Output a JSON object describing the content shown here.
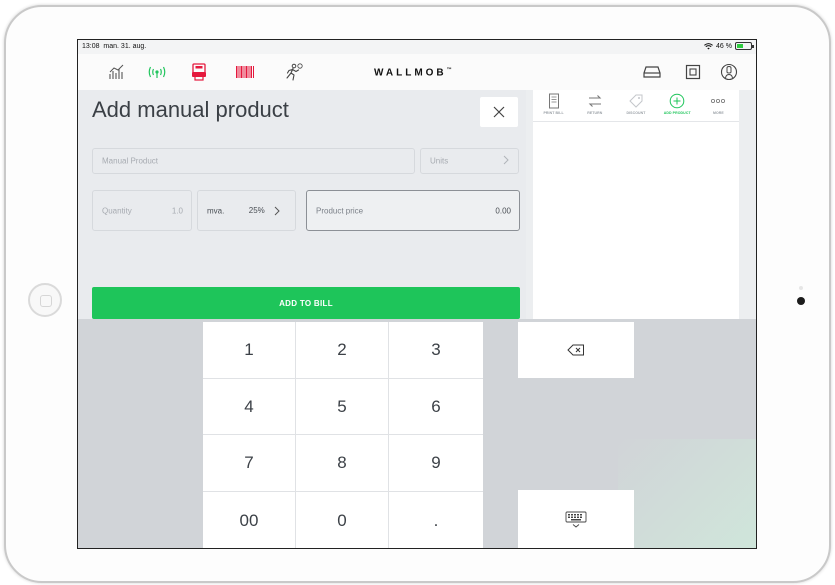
{
  "status": {
    "time": "13:08",
    "date": "man. 31. aug.",
    "battery": "46 %",
    "battery_level": 0.46
  },
  "topbar": {
    "brand": "WALLMOB",
    "brand_tm": "™",
    "left_icons": [
      "chart-icon",
      "wifi-signal-icon",
      "printer-icon",
      "barcode-icon",
      "running-person-icon"
    ],
    "right_icons": [
      "cash-drawer-icon",
      "register-icon",
      "user-icon"
    ],
    "colors": {
      "active_icon": "#22c55e",
      "alert_icon": "#e5183d"
    }
  },
  "form": {
    "title": "Add manual product",
    "close_label": "✕",
    "product_name_placeholder": "Manual Product",
    "units_label": "Units",
    "quantity_label": "Quantity",
    "quantity_value": "1.0",
    "vat_label": "mva.",
    "vat_value": "25%",
    "price_label": "Product price",
    "price_value": "0.00",
    "add_button": "ADD TO BILL",
    "accent": "#1ec55a"
  },
  "bill_tabs": [
    {
      "label": "PRINT BILL",
      "icon": "bill-icon"
    },
    {
      "label": "RETURN",
      "icon": "return-icon"
    },
    {
      "label": "DISCOUNT",
      "icon": "tag-icon"
    },
    {
      "label": "ADD PRODUCT",
      "icon": "plus-circle-icon"
    },
    {
      "label": "MORE",
      "icon": "more-icon"
    }
  ],
  "keypad": {
    "keys": [
      "1",
      "2",
      "3",
      "4",
      "5",
      "6",
      "7",
      "8",
      "9",
      "00",
      "0",
      "."
    ],
    "backspace_icon": "backspace-icon",
    "keyboard_icon": "keyboard-hide-icon"
  }
}
